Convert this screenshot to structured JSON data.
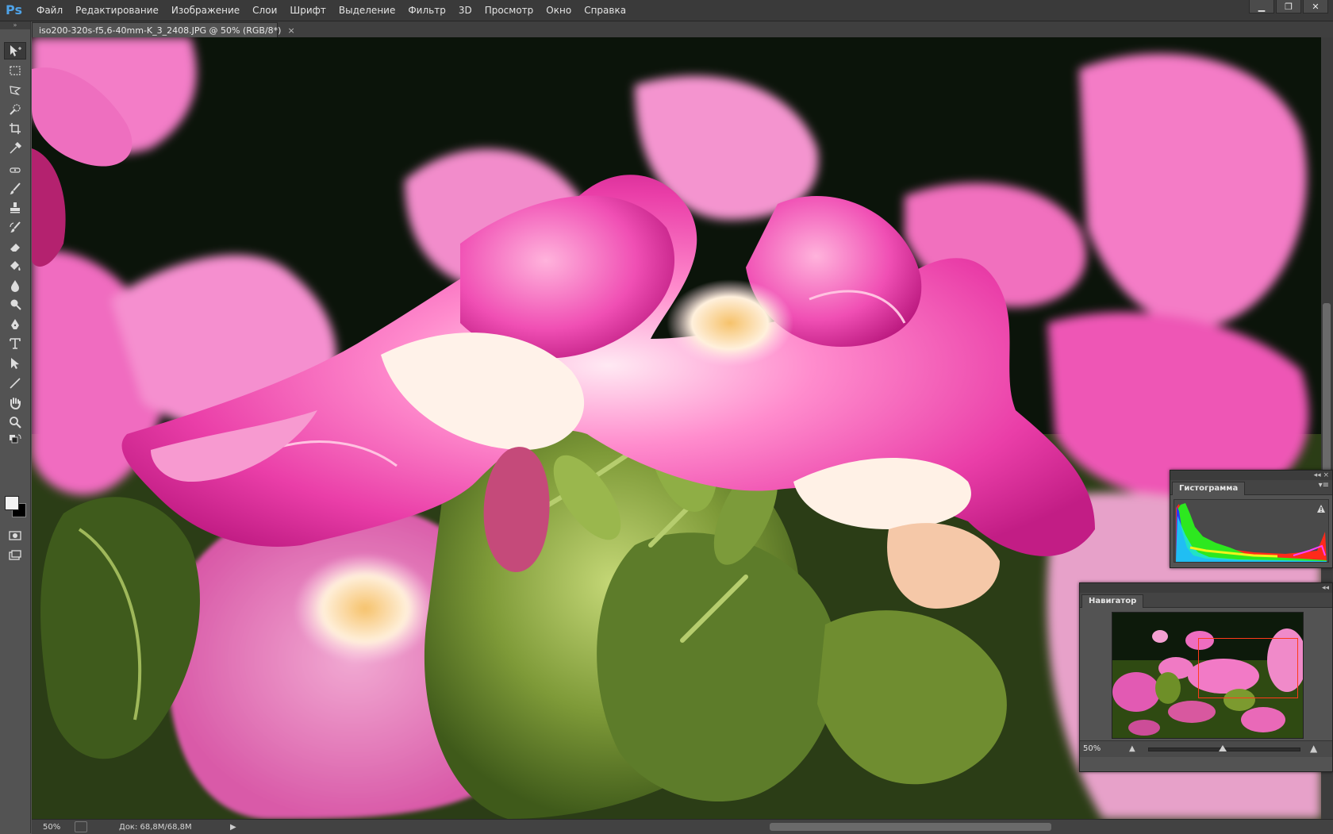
{
  "app": {
    "logo": "Ps"
  },
  "menu": [
    "Файл",
    "Редактирование",
    "Изображение",
    "Слои",
    "Шрифт",
    "Выделение",
    "Фильтр",
    "3D",
    "Просмотр",
    "Окно",
    "Справка"
  ],
  "window_controls": {
    "minimize": "▁",
    "restore": "❐",
    "close": "✕"
  },
  "document": {
    "tab_title": "iso200-320s-f5,6-40mm-K_3_2408.JPG @ 50% (RGB/8*)",
    "close_glyph": "×"
  },
  "status": {
    "zoom": "50%",
    "doc_info": "Док: 68,8M/68,8M",
    "arrow": "▶"
  },
  "panels": {
    "histogram": {
      "title": "Гистограмма",
      "menu_glyph": "▾≡",
      "collapse_glyphs": "◂◂  ×"
    },
    "navigator": {
      "title": "Навигатор",
      "zoom": "50%",
      "zoom_out_glyph": "▲",
      "zoom_in_glyph": "▲",
      "collapse_glyphs": "◂◂"
    }
  },
  "tools": [
    "move-tool",
    "marquee-tool",
    "lasso-tool",
    "quick-selection-tool",
    "crop-tool",
    "eyedropper-tool",
    "spot-healing-tool",
    "brush-tool",
    "clone-stamp-tool",
    "history-brush-tool",
    "eraser-tool",
    "paint-bucket-tool",
    "blur-tool",
    "dodge-tool",
    "pen-tool",
    "type-tool",
    "path-selection-tool",
    "line-tool",
    "hand-tool",
    "zoom-tool",
    "quick-mask-tool",
    "screen-mode-tool"
  ],
  "colors": {
    "foreground": "#f2f2f2",
    "background": "#000000",
    "nav_viewbox": "#ff3a1a"
  }
}
